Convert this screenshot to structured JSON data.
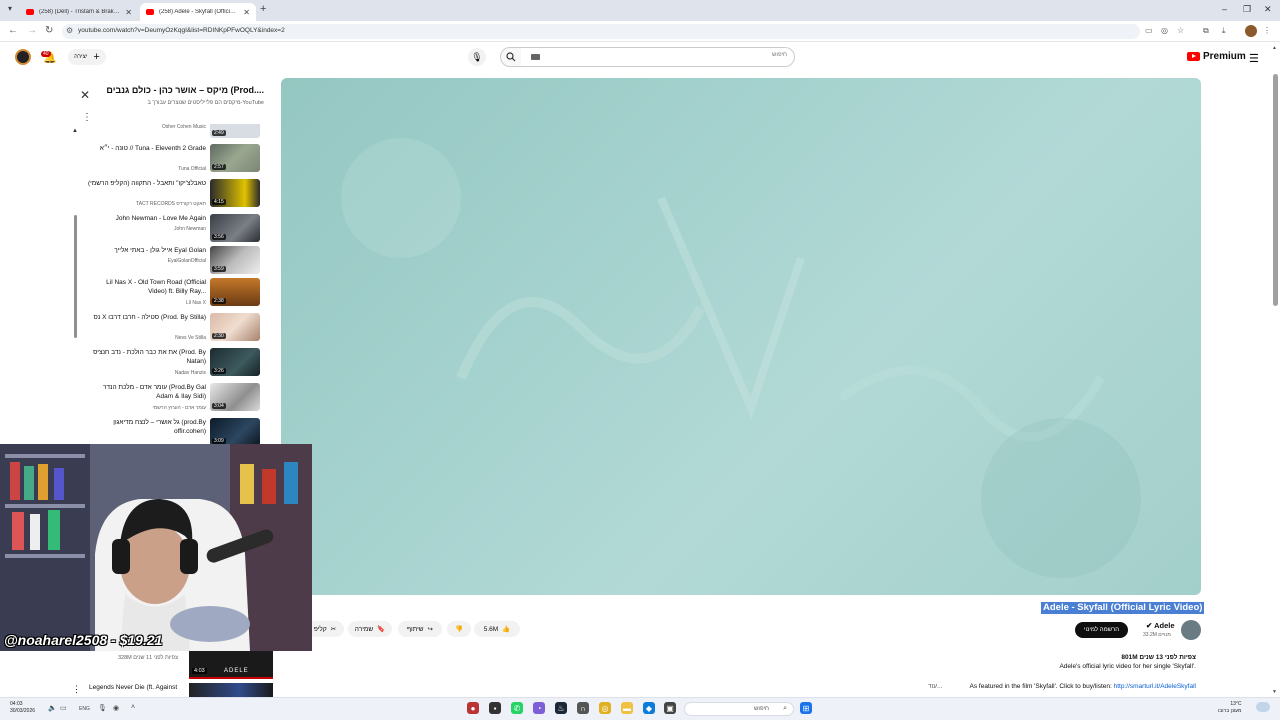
{
  "browser": {
    "tabs": [
      {
        "label": "(258) (Dell) - Tristam & Braken",
        "active": false
      },
      {
        "label": "(258) Adele - Skyfall (Official Ly...",
        "active": true
      }
    ],
    "new_tab": "+",
    "url": "youtube.com/watch?v=DeumyOzKqgI&list=RDINKpPFwOQLY&index=2"
  },
  "header": {
    "notification_count": "40",
    "create_label": "יצירה",
    "search_placeholder": "חיפוש",
    "premium_label": "Premium"
  },
  "playlist": {
    "title": "מיקס – אושר כהן - כולם גנבים (Prod....",
    "subtitle": "מיקסים הם פלייליסטים שנוצרים עבורך ב-YouTube",
    "partial_item": {
      "channel": "Osher Cohen Music",
      "duration": "2:49"
    },
    "items": [
      {
        "title": "טונה - י״א // Tuna - Eleventh 2 Grade",
        "channel": "Tuna Official",
        "duration": "2:57"
      },
      {
        "title": "טאבלצ'יקו\" ותאבל - התקווה (הקליפ הרשמי)",
        "channel": "TACT RECORDS תאקט רקורדס",
        "duration": "4:15"
      },
      {
        "title": "John Newman - Love Me Again",
        "channel": "John Newman",
        "duration": "3:56"
      },
      {
        "title": "אייל גולן - באתי אלייך Eyal Golan",
        "channel": "EyalGolanOfficial",
        "duration": "3:59"
      },
      {
        "title": "Lil Nas X - Old Town Road (Official Video) ft. Billy Ray...",
        "channel": "Lil Nas X",
        "duration": "2:38"
      },
      {
        "title": "נס X סטילה - חרבו דרבו (Prod. By Stilla)",
        "channel": "Ness Ve Stilla",
        "duration": "2:30"
      },
      {
        "title": "את את כבר הולכת - נדב חנציס (Prod. By Natan)",
        "channel": "Nadav Hanzis",
        "duration": "3:26"
      },
      {
        "title": "עומר אדם - מלכת הנדר (Prod.By Gal Adam & Ilay Sidi)",
        "channel": "עומר אדם - הערוץ הרשמי",
        "duration": "3:04"
      },
      {
        "title": "גל אושרי – לנצח מדיאגון (prod.By offir.cohen)",
        "channel": "",
        "duration": "3:09"
      }
    ]
  },
  "video": {
    "title": "Adele - Skyfall (Official Lyric Video)",
    "channel": "Adele",
    "subscribers": "33.2M מנויים",
    "subscribe_label": "הרשמה למינוי",
    "likes": "5.6M",
    "share_label": "שיתוף",
    "save_label": "שמירה",
    "clip_label": "קליפ",
    "description_meta": "801M צפיות  לפני 13 שנים",
    "description_line1": "Adele's official lyric video for her single 'Skyfall'.",
    "description_line2_prefix": "As featured in the film 'Skyfall'. Click to buy/listen: ",
    "description_link": "http://smarturl.it/AdeleSkyfall",
    "description_more": "עוד..."
  },
  "webcam": {
    "overlay_text": "@noaharel2508 - $19.21"
  },
  "recommendations": {
    "peek_meta": "328M צפיות  לפני 11 שנים",
    "peek_duration": "4:03",
    "peek_thumb_text": "ADELE",
    "next_title": "Legends Never Die (ft. Against"
  },
  "taskbar": {
    "time": "04:03",
    "date": "30/03/2026",
    "lang": "ENG",
    "search_placeholder": "חיפוש",
    "weather_temp": "13°C",
    "weather_desc": "מעונן ברובו"
  },
  "colors": {
    "accent": "#ff0000",
    "link": "#065fd4",
    "highlight": "#4a7fd4",
    "player_bg": "#a5d2ce"
  }
}
